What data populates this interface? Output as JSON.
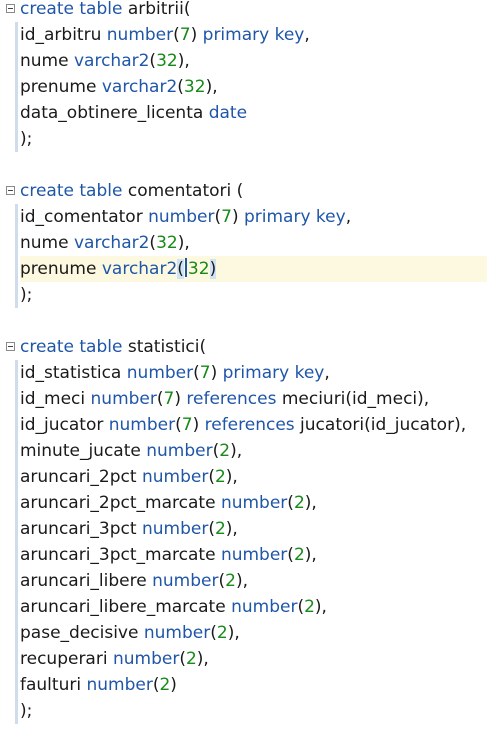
{
  "tables": [
    {
      "id": "arbitrii",
      "lines": [
        [
          {
            "t": "create table",
            "k": "kw"
          },
          {
            "t": " arbitrii(",
            "k": "txt"
          }
        ],
        [
          {
            "t": "id_arbitru ",
            "k": "txt"
          },
          {
            "t": "number",
            "k": "kw"
          },
          {
            "t": "(",
            "k": "txt"
          },
          {
            "t": "7",
            "k": "num"
          },
          {
            "t": ") ",
            "k": "txt"
          },
          {
            "t": "primary key",
            "k": "kw"
          },
          {
            "t": ",",
            "k": "txt"
          }
        ],
        [
          {
            "t": "nume ",
            "k": "txt"
          },
          {
            "t": "varchar2",
            "k": "kw"
          },
          {
            "t": "(",
            "k": "txt"
          },
          {
            "t": "32",
            "k": "num"
          },
          {
            "t": "),",
            "k": "txt"
          }
        ],
        [
          {
            "t": "prenume ",
            "k": "txt"
          },
          {
            "t": "varchar2",
            "k": "kw"
          },
          {
            "t": "(",
            "k": "txt"
          },
          {
            "t": "32",
            "k": "num"
          },
          {
            "t": "),",
            "k": "txt"
          }
        ],
        [
          {
            "t": "data_obtinere_licenta ",
            "k": "txt"
          },
          {
            "t": "date",
            "k": "kw"
          }
        ],
        [
          {
            "t": ");",
            "k": "txt"
          }
        ]
      ]
    },
    {
      "id": "comentatori",
      "lines": [
        [
          {
            "t": "create table",
            "k": "kw"
          },
          {
            "t": " comentatori (",
            "k": "txt"
          }
        ],
        [
          {
            "t": "id_comentator ",
            "k": "txt"
          },
          {
            "t": "number",
            "k": "kw"
          },
          {
            "t": "(",
            "k": "txt"
          },
          {
            "t": "7",
            "k": "num"
          },
          {
            "t": ") ",
            "k": "txt"
          },
          {
            "t": "primary key",
            "k": "kw"
          },
          {
            "t": ",",
            "k": "txt"
          }
        ],
        [
          {
            "t": "nume ",
            "k": "txt"
          },
          {
            "t": "varchar2",
            "k": "kw"
          },
          {
            "t": "(",
            "k": "txt"
          },
          {
            "t": "32",
            "k": "num"
          },
          {
            "t": "),",
            "k": "txt"
          }
        ],
        [
          {
            "t": "prenume ",
            "k": "txt"
          },
          {
            "t": "varchar2",
            "k": "kw"
          },
          {
            "t": "(",
            "k": "caret"
          },
          {
            "t": "32",
            "k": "num"
          },
          {
            "t": ")",
            "k": "paren"
          }
        ],
        [
          {
            "t": ");",
            "k": "txt"
          }
        ]
      ]
    },
    {
      "id": "statistici",
      "lines": [
        [
          {
            "t": "create table",
            "k": "kw"
          },
          {
            "t": " statistici(",
            "k": "txt"
          }
        ],
        [
          {
            "t": "id_statistica ",
            "k": "txt"
          },
          {
            "t": "number",
            "k": "kw"
          },
          {
            "t": "(",
            "k": "txt"
          },
          {
            "t": "7",
            "k": "num"
          },
          {
            "t": ") ",
            "k": "txt"
          },
          {
            "t": "primary key",
            "k": "kw"
          },
          {
            "t": ",",
            "k": "txt"
          }
        ],
        [
          {
            "t": "id_meci ",
            "k": "txt"
          },
          {
            "t": "number",
            "k": "kw"
          },
          {
            "t": "(",
            "k": "txt"
          },
          {
            "t": "7",
            "k": "num"
          },
          {
            "t": ") ",
            "k": "txt"
          },
          {
            "t": "references",
            "k": "kw"
          },
          {
            "t": " meciuri(id_meci),",
            "k": "txt"
          }
        ],
        [
          {
            "t": "id_jucator ",
            "k": "txt"
          },
          {
            "t": "number",
            "k": "kw"
          },
          {
            "t": "(",
            "k": "txt"
          },
          {
            "t": "7",
            "k": "num"
          },
          {
            "t": ") ",
            "k": "txt"
          },
          {
            "t": "references",
            "k": "kw"
          },
          {
            "t": " jucatori(id_jucator),",
            "k": "txt"
          }
        ],
        [
          {
            "t": "minute_jucate ",
            "k": "txt"
          },
          {
            "t": "number",
            "k": "kw"
          },
          {
            "t": "(",
            "k": "txt"
          },
          {
            "t": "2",
            "k": "num"
          },
          {
            "t": "),",
            "k": "txt"
          }
        ],
        [
          {
            "t": "aruncari_2pct ",
            "k": "txt"
          },
          {
            "t": "number",
            "k": "kw"
          },
          {
            "t": "(",
            "k": "txt"
          },
          {
            "t": "2",
            "k": "num"
          },
          {
            "t": "),",
            "k": "txt"
          }
        ],
        [
          {
            "t": "aruncari_2pct_marcate ",
            "k": "txt"
          },
          {
            "t": "number",
            "k": "kw"
          },
          {
            "t": "(",
            "k": "txt"
          },
          {
            "t": "2",
            "k": "num"
          },
          {
            "t": "),",
            "k": "txt"
          }
        ],
        [
          {
            "t": "aruncari_3pct ",
            "k": "txt"
          },
          {
            "t": "number",
            "k": "kw"
          },
          {
            "t": "(",
            "k": "txt"
          },
          {
            "t": "2",
            "k": "num"
          },
          {
            "t": "),",
            "k": "txt"
          }
        ],
        [
          {
            "t": "aruncari_3pct_marcate ",
            "k": "txt"
          },
          {
            "t": "number",
            "k": "kw"
          },
          {
            "t": "(",
            "k": "txt"
          },
          {
            "t": "2",
            "k": "num"
          },
          {
            "t": "),",
            "k": "txt"
          }
        ],
        [
          {
            "t": "aruncari_libere ",
            "k": "txt"
          },
          {
            "t": "number",
            "k": "kw"
          },
          {
            "t": "(",
            "k": "txt"
          },
          {
            "t": "2",
            "k": "num"
          },
          {
            "t": "),",
            "k": "txt"
          }
        ],
        [
          {
            "t": "aruncari_libere_marcate ",
            "k": "txt"
          },
          {
            "t": "number",
            "k": "kw"
          },
          {
            "t": "(",
            "k": "txt"
          },
          {
            "t": "2",
            "k": "num"
          },
          {
            "t": "),",
            "k": "txt"
          }
        ],
        [
          {
            "t": "pase_decisive ",
            "k": "txt"
          },
          {
            "t": "number",
            "k": "kw"
          },
          {
            "t": "(",
            "k": "txt"
          },
          {
            "t": "2",
            "k": "num"
          },
          {
            "t": "),",
            "k": "txt"
          }
        ],
        [
          {
            "t": "recuperari ",
            "k": "txt"
          },
          {
            "t": "number",
            "k": "kw"
          },
          {
            "t": "(",
            "k": "txt"
          },
          {
            "t": "2",
            "k": "num"
          },
          {
            "t": "),",
            "k": "txt"
          }
        ],
        [
          {
            "t": "faulturi ",
            "k": "txt"
          },
          {
            "t": "number",
            "k": "kw"
          },
          {
            "t": "(",
            "k": "txt"
          },
          {
            "t": "2",
            "k": "num"
          },
          {
            "t": ")",
            "k": "txt"
          }
        ],
        [
          {
            "t": ");",
            "k": "txt"
          }
        ]
      ]
    }
  ],
  "colors": {
    "keyword": "#1f56a8",
    "number": "#168a16",
    "text": "#1a1a1a",
    "active_line": "#fdf9e0"
  }
}
